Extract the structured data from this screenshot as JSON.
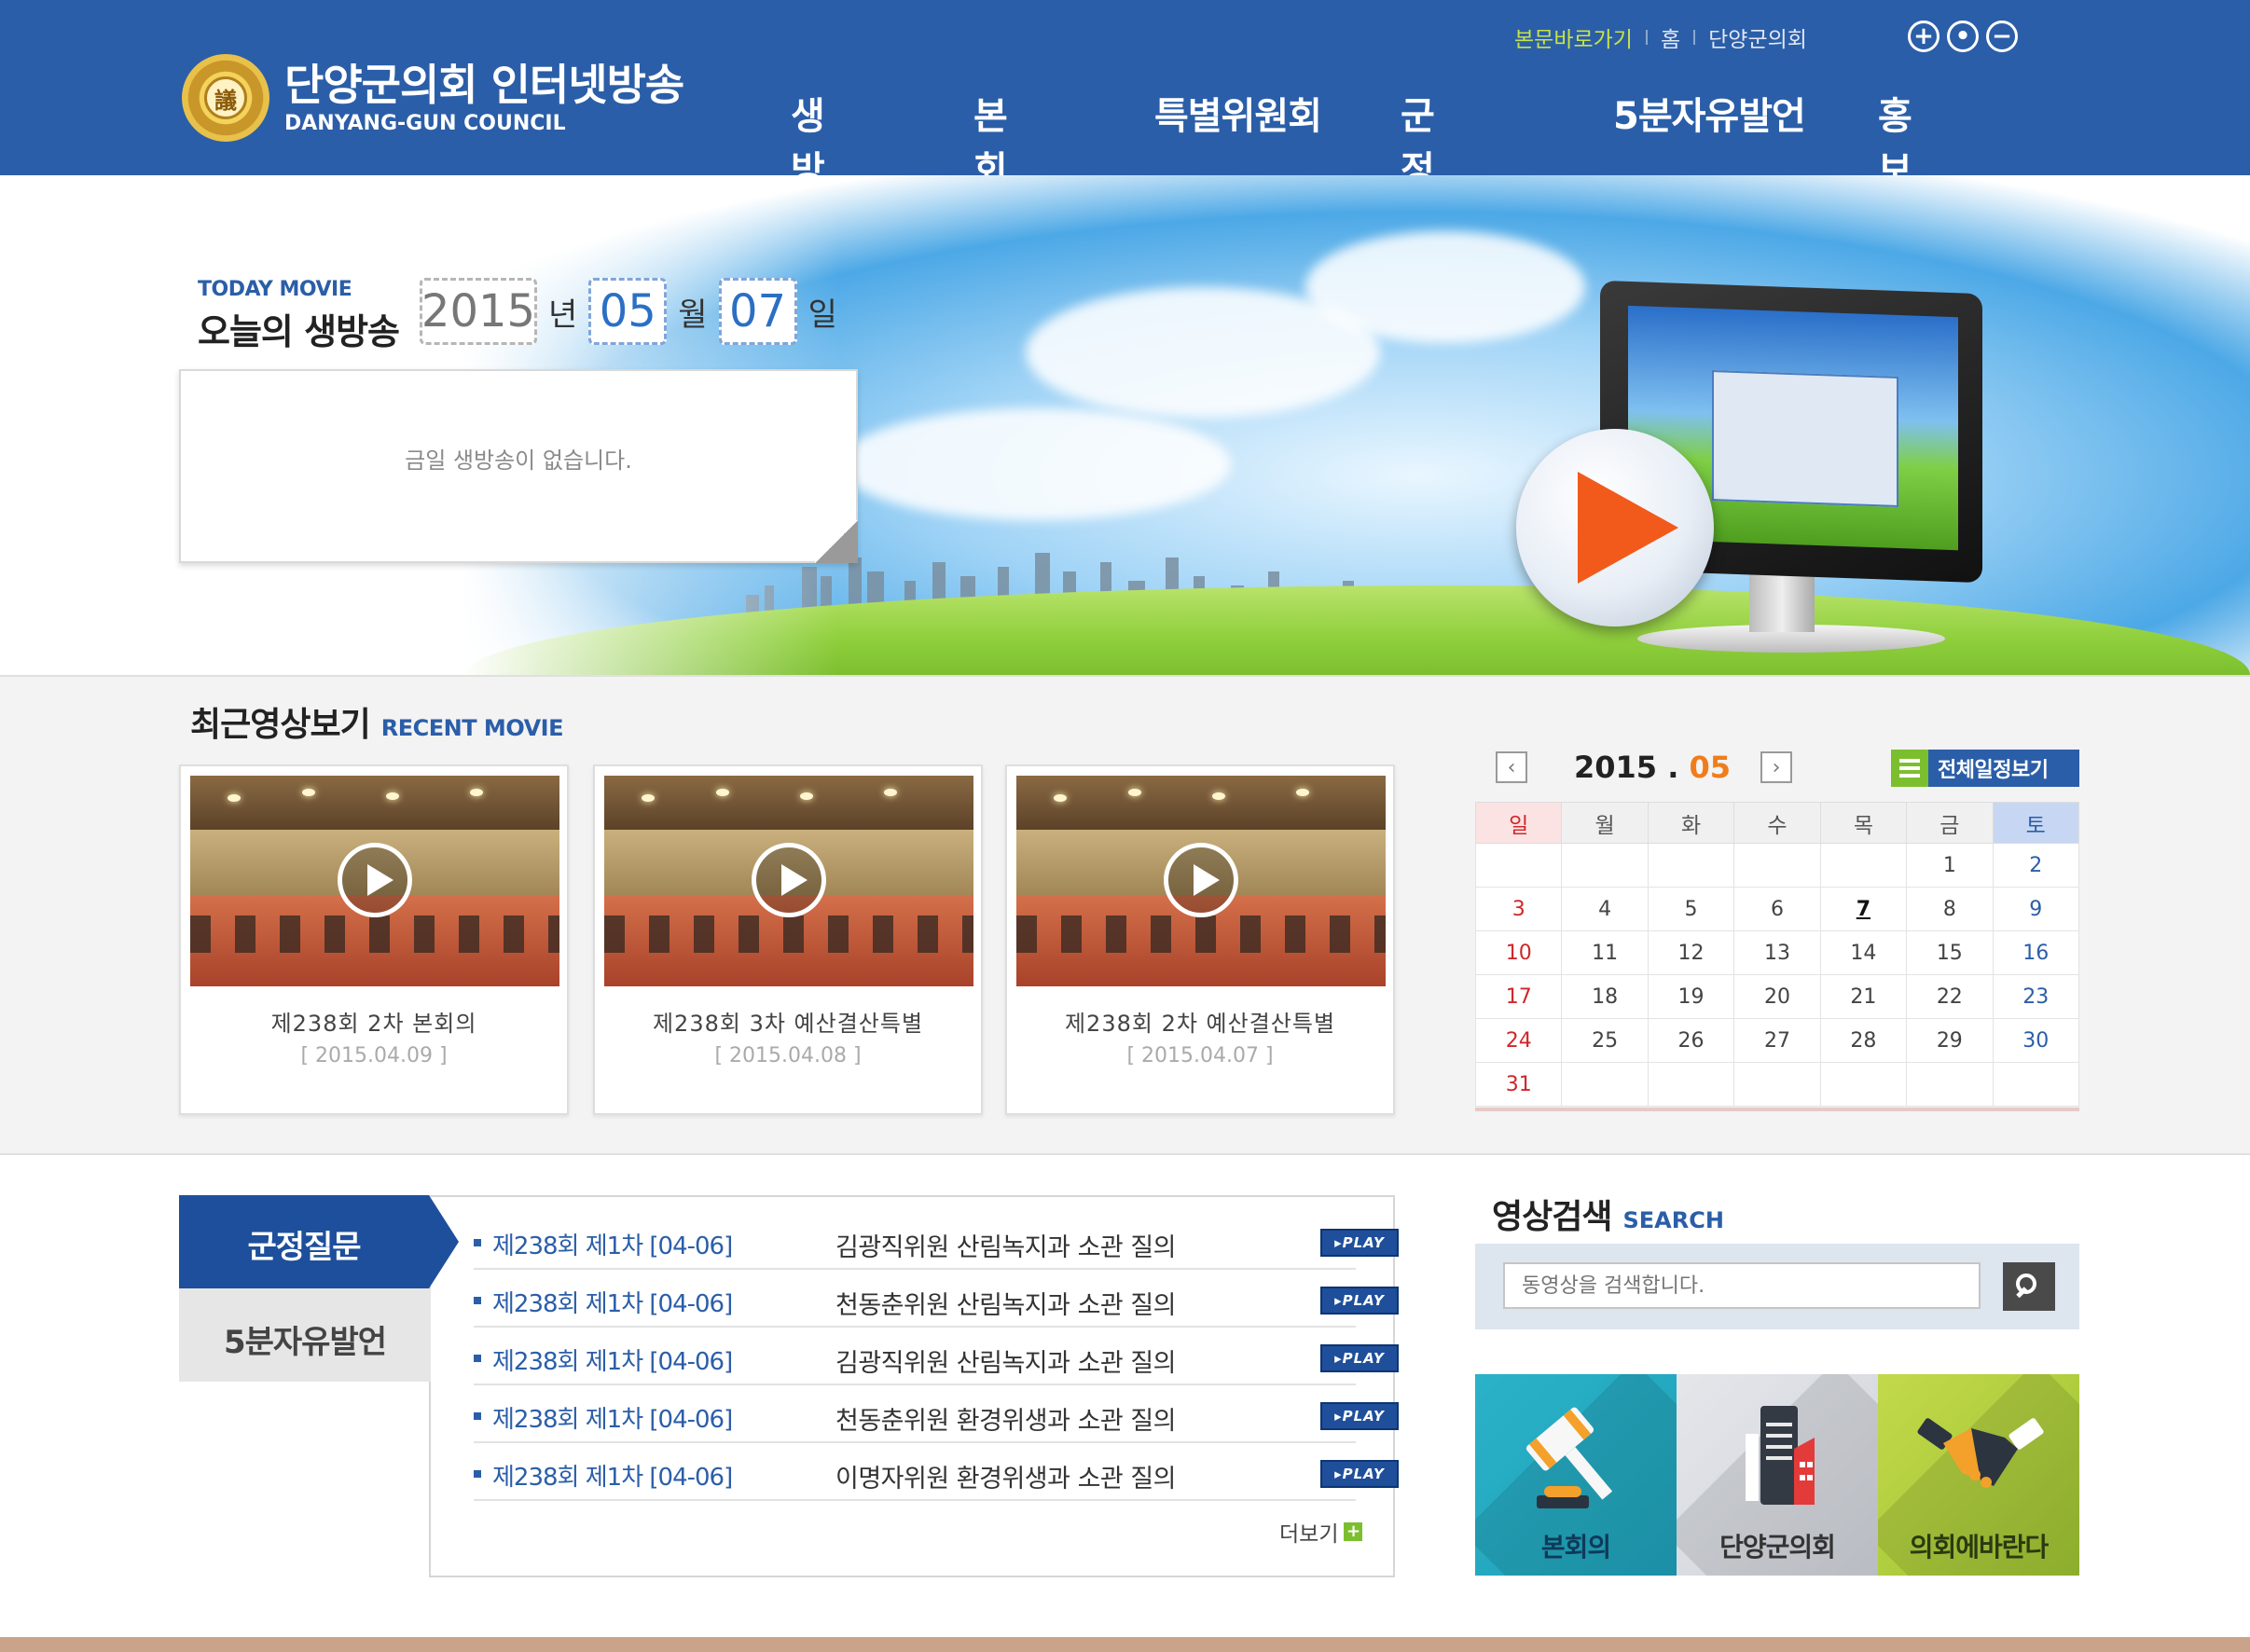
{
  "header": {
    "logo_title": "단양군의회 인터넷방송",
    "logo_sub": "DANYANG-GUN COUNCIL",
    "util": {
      "skip": "본문바로가기",
      "home": "홈",
      "council": "단양군의회"
    },
    "zoom": {
      "in": "+",
      "reset": "•",
      "out": "−"
    },
    "nav": [
      "생방송",
      "본회의",
      "특별위원회",
      "군정질문",
      "5분자유발언",
      "홍보영상"
    ]
  },
  "today": {
    "label_en": "TODAY MOVIE",
    "label_ko": "오늘의 생방송",
    "year": "2015",
    "year_unit": "년",
    "month": "05",
    "month_unit": "월",
    "day": "07",
    "day_unit": "일",
    "message": "금일 생방송이 없습니다."
  },
  "recent": {
    "title_ko": "최근영상보기",
    "title_en": "RECENT MOVIE",
    "videos": [
      {
        "title": "제238회 2차 본회의",
        "date": "[ 2015.04.09 ]"
      },
      {
        "title": "제238회 3차 예산결산특별",
        "date": "[ 2015.04.08 ]"
      },
      {
        "title": "제238회 2차 예산결산특별",
        "date": "[ 2015.04.07 ]"
      }
    ]
  },
  "calendar": {
    "year": "2015 .",
    "month": "05",
    "all_schedule": "전체일정보기",
    "weekdays": [
      "일",
      "월",
      "화",
      "수",
      "목",
      "금",
      "토"
    ],
    "weeks": [
      [
        "",
        "",
        "",
        "",
        "",
        "1",
        "2"
      ],
      [
        "3",
        "4",
        "5",
        "6",
        "7",
        "8",
        "9"
      ],
      [
        "10",
        "11",
        "12",
        "13",
        "14",
        "15",
        "16"
      ],
      [
        "17",
        "18",
        "19",
        "20",
        "21",
        "22",
        "23"
      ],
      [
        "24",
        "25",
        "26",
        "27",
        "28",
        "29",
        "30"
      ],
      [
        "31",
        "",
        "",
        "",
        "",
        "",
        ""
      ]
    ],
    "today": "7"
  },
  "tabs": {
    "active": "군정질문",
    "inactive": "5분자유발언"
  },
  "questions": [
    {
      "session": "제238회 제1차 [04-06]",
      "title": "김광직위원 산림녹지과 소관 질의",
      "play": "PLAY"
    },
    {
      "session": "제238회 제1차 [04-06]",
      "title": "천동춘위원 산림녹지과 소관 질의",
      "play": "PLAY"
    },
    {
      "session": "제238회 제1차 [04-06]",
      "title": "김광직위원 산림녹지과 소관 질의",
      "play": "PLAY"
    },
    {
      "session": "제238회 제1차 [04-06]",
      "title": "천동춘위원 환경위생과 소관 질의",
      "play": "PLAY"
    },
    {
      "session": "제238회 제1차 [04-06]",
      "title": "이명자위원 환경위생과 소관 질의",
      "play": "PLAY"
    }
  ],
  "more": "더보기",
  "search": {
    "title_ko": "영상검색",
    "title_en": "SEARCH",
    "placeholder": "동영상을 검색합니다."
  },
  "tiles": [
    {
      "label": "본회의",
      "icon": "gavel-icon"
    },
    {
      "label": "단양군의회",
      "icon": "building-icon"
    },
    {
      "label": "의회에바란다",
      "icon": "handshake-icon"
    }
  ],
  "colors": {
    "brand_blue": "#2b5ea8",
    "accent_green": "#7cbf2e",
    "accent_orange": "#f07d1a",
    "play_orange": "#f15a1b"
  }
}
